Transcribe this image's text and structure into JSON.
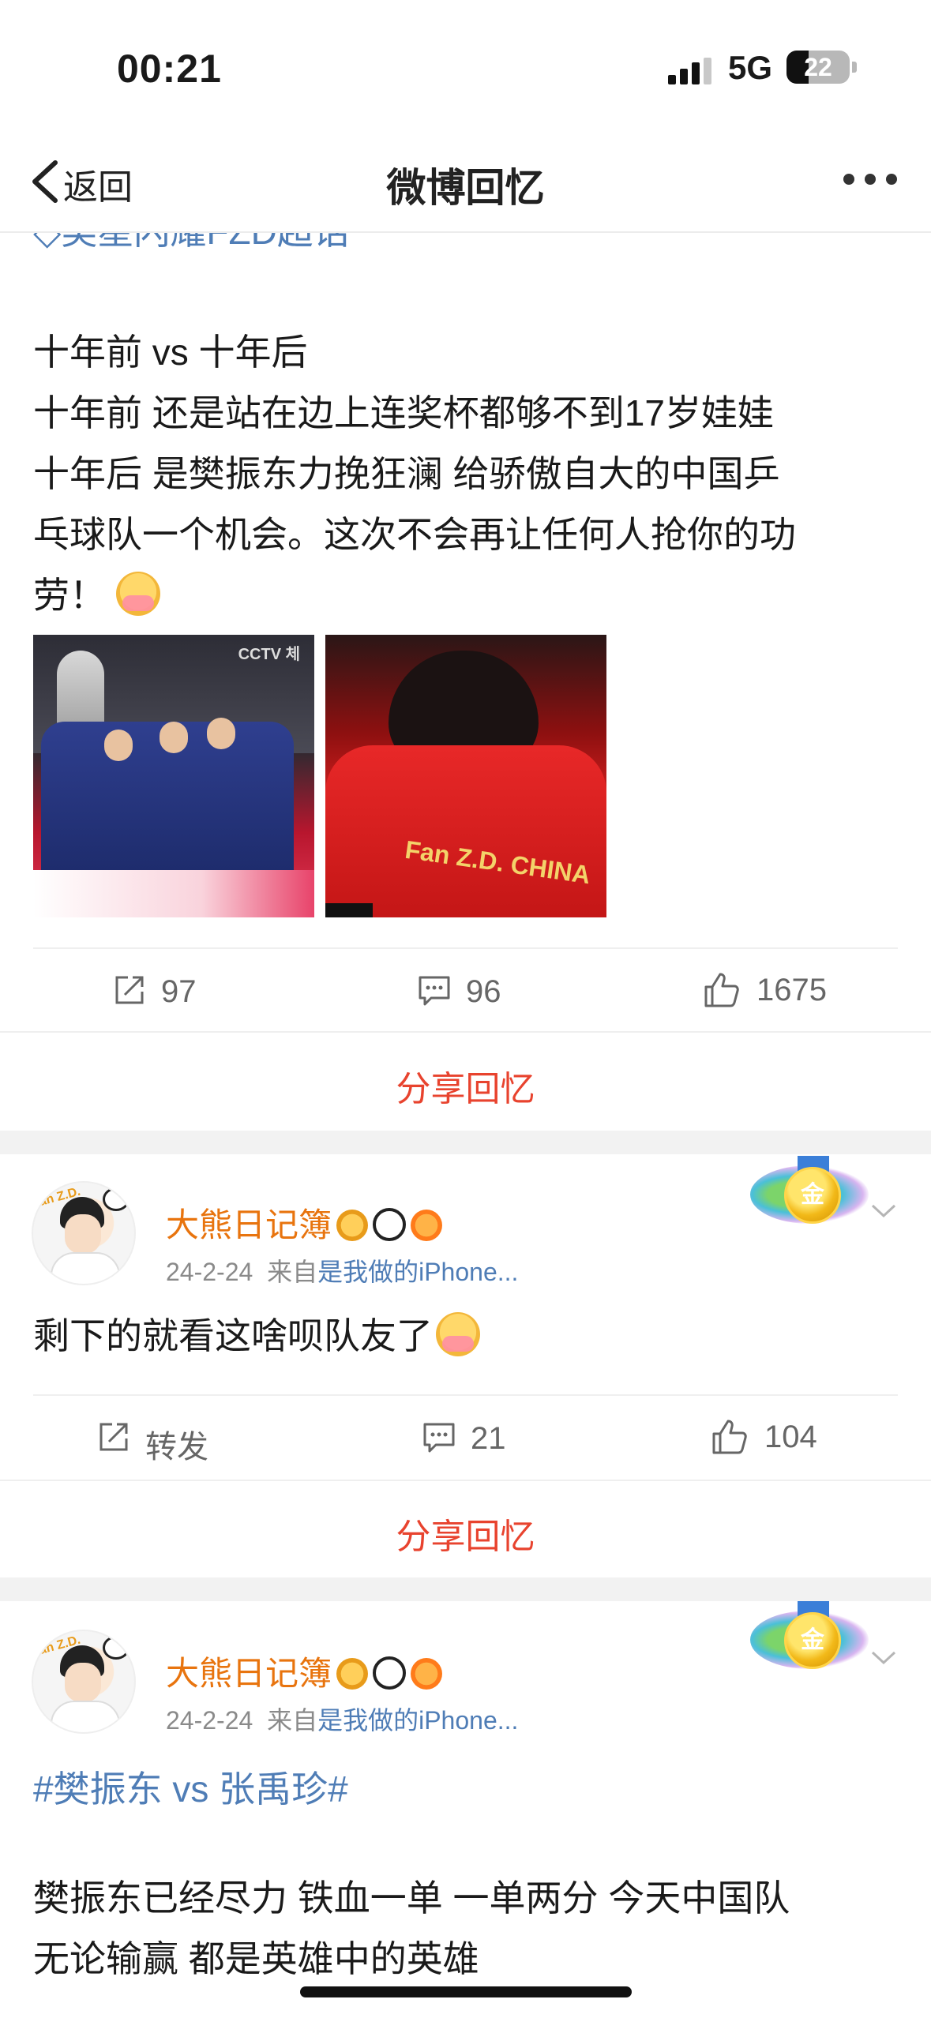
{
  "status_bar": {
    "time": "00:21",
    "network": "5G",
    "battery": "22"
  },
  "nav": {
    "back_label": "返回",
    "title": "微博回忆"
  },
  "post1": {
    "topic_cut": "◇樊星闪耀FZD超话",
    "lines": [
      "十年前 vs 十年后",
      "十年前 还是站在边上连奖杯都够不到17岁娃娃",
      "十年后 是樊振东力挽狂澜 给骄傲自大的中国乒",
      "乓球队一个机会。这次不会再让任何人抢你的功",
      "劳！"
    ],
    "image1_watermark": "CCTV 체",
    "image2_jersey": "Fan Z.D. CHINA",
    "reposts": "97",
    "comments": "96",
    "likes": "1675",
    "share": "分享回忆"
  },
  "post2": {
    "username": "大熊日记簿",
    "date": "24-2-24",
    "source_prefix": "来自",
    "source": "是我做的iPhone...",
    "medal": "金",
    "text": "剩下的就看这啥呗队友了",
    "repost_label": "转发",
    "comments": "21",
    "likes": "104",
    "share": "分享回忆"
  },
  "post3": {
    "username": "大熊日记簿",
    "date": "24-2-24",
    "source_prefix": "来自",
    "source": "是我做的iPhone...",
    "medal": "金",
    "hashtag": "#樊振东 vs 张禹珍#",
    "lines": [
      "樊振东已经尽力 铁血一单 一单两分 今天中国队",
      "无论输赢 都是英雄中的英雄"
    ]
  }
}
